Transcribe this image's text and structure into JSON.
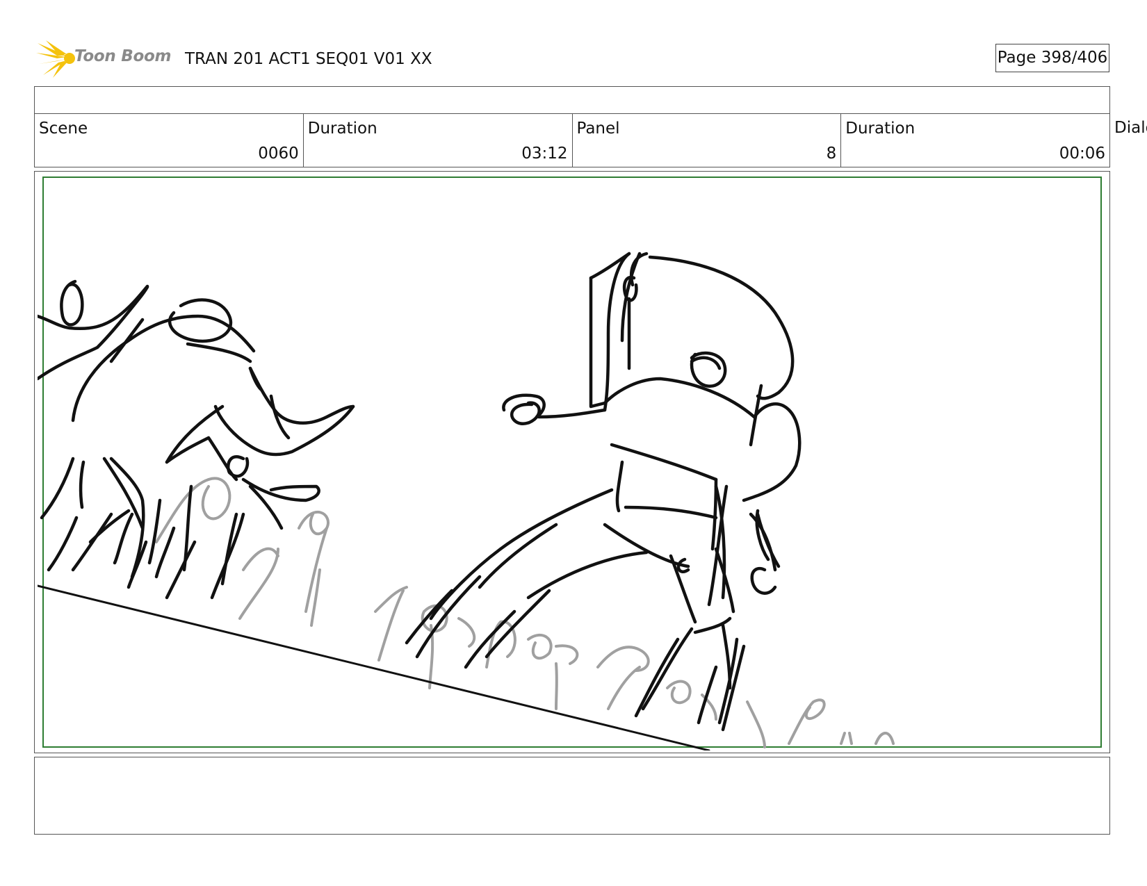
{
  "header": {
    "brand_name": "Toon Boom",
    "title": "TRAN 201 ACT1 SEQ01 V01 XX",
    "page_label": "Page 398/406"
  },
  "info": {
    "cells": [
      {
        "label": "Scene",
        "value": "0060"
      },
      {
        "label": "Duration",
        "value": "03:12"
      },
      {
        "label": "Panel",
        "value": "8"
      },
      {
        "label": "Duration",
        "value": "00:06"
      }
    ],
    "overflow_label": "Dialo"
  },
  "panel": {
    "frame_color": "#2e7d32",
    "ink_color": "#111111",
    "crowd_color": "#a0a0a0"
  },
  "icons": {
    "logo": "toon-boom-logo-icon"
  }
}
